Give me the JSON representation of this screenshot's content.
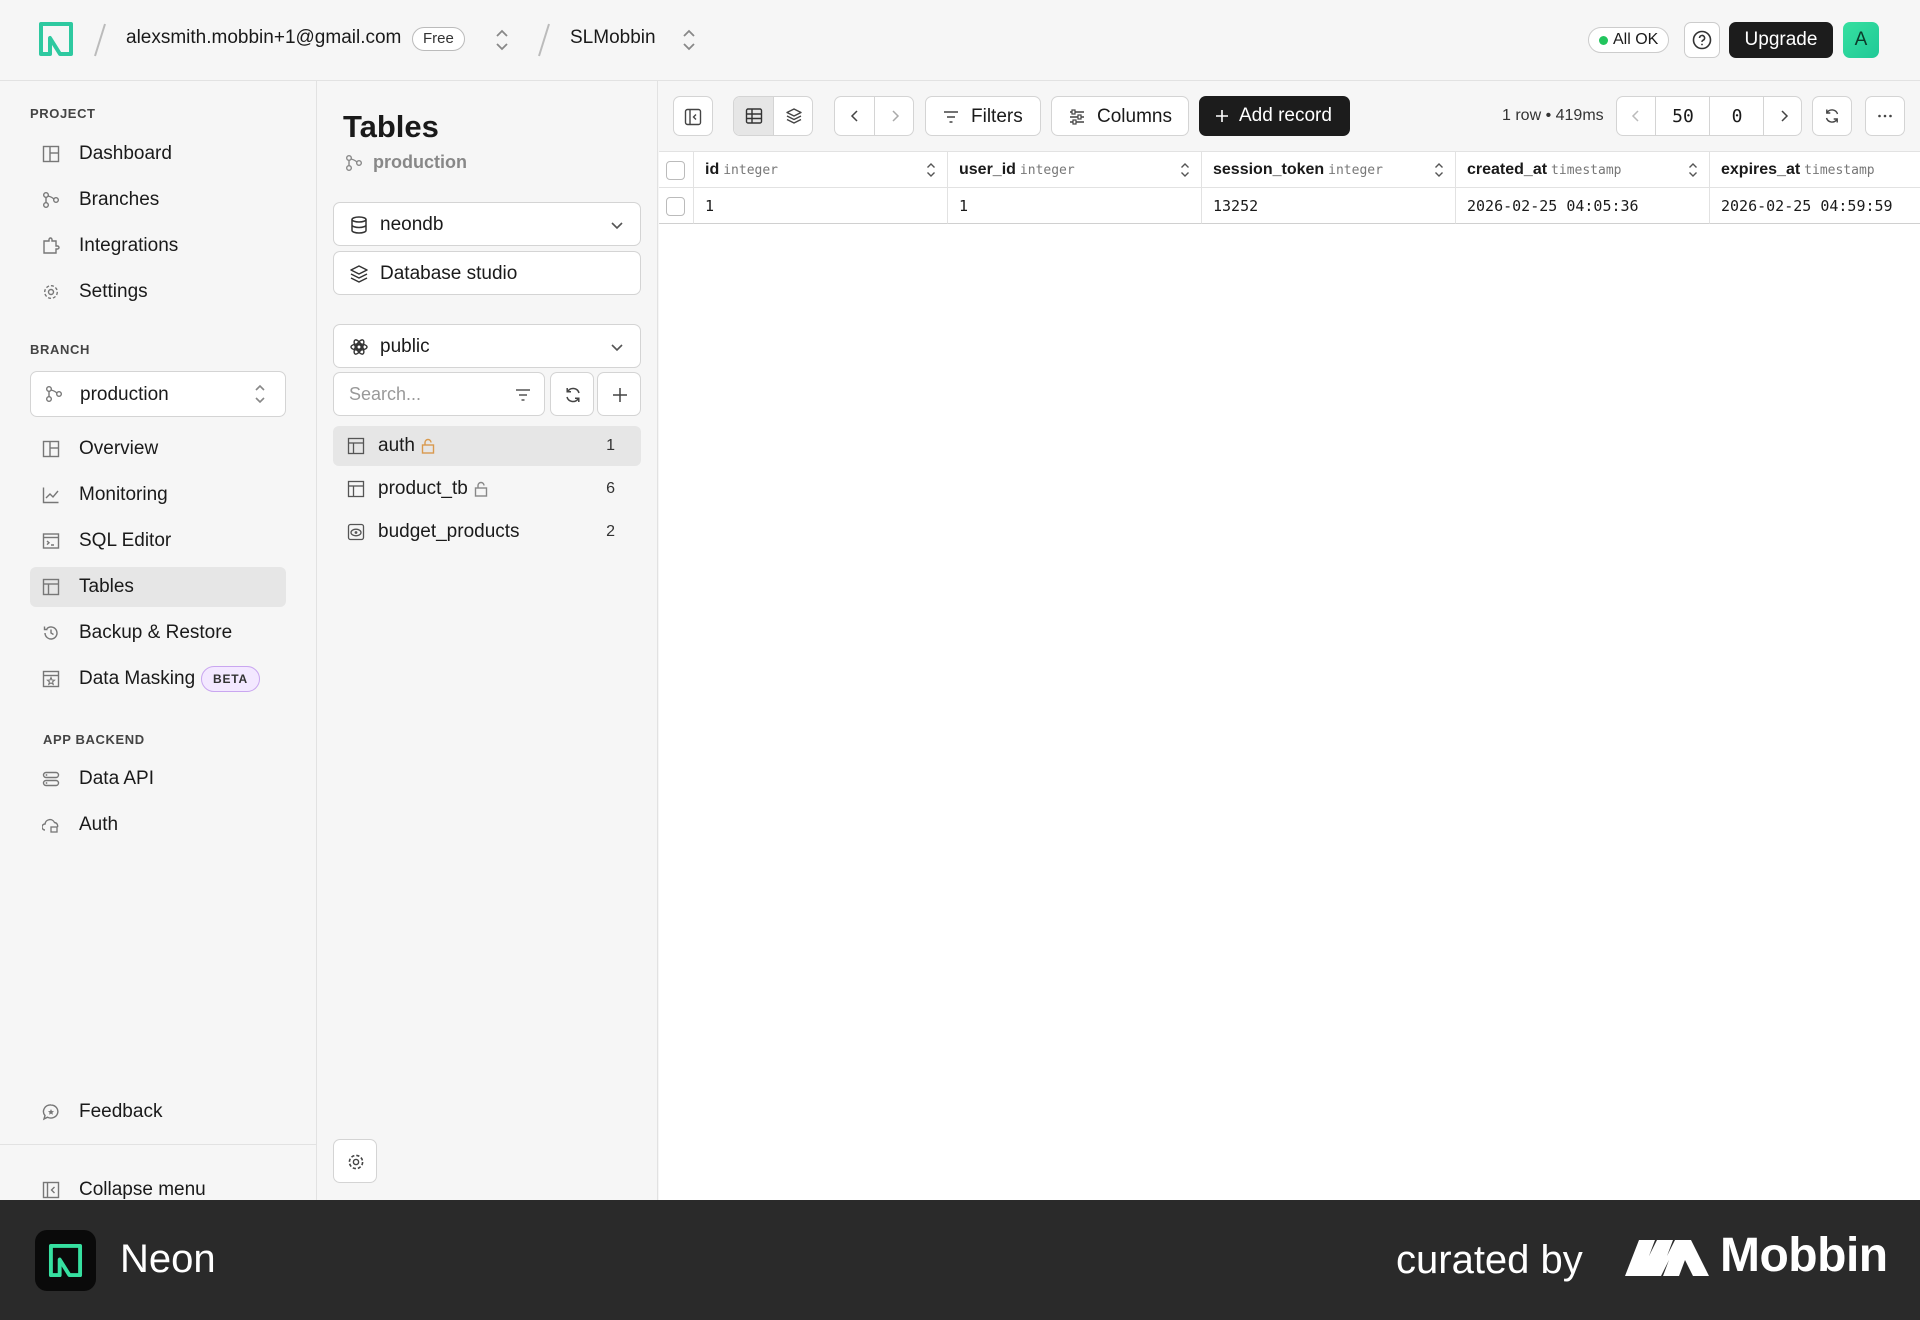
{
  "topbar": {
    "account": "alexsmith.mobbin+1@gmail.com",
    "plan_badge": "Free",
    "project": "SLMobbin",
    "status": "All OK",
    "upgrade_label": "Upgrade",
    "avatar_letter": "A"
  },
  "sidebar": {
    "project_label": "PROJECT",
    "project_items": [
      {
        "label": "Dashboard",
        "icon": "dashboard-icon"
      },
      {
        "label": "Branches",
        "icon": "branches-icon"
      },
      {
        "label": "Integrations",
        "icon": "integrations-icon"
      },
      {
        "label": "Settings",
        "icon": "gear-icon"
      }
    ],
    "branch_label": "BRANCH",
    "branch_selected": "production",
    "branch_items": [
      {
        "label": "Overview",
        "icon": "overview-icon"
      },
      {
        "label": "Monitoring",
        "icon": "chart-icon"
      },
      {
        "label": "SQL Editor",
        "icon": "terminal-icon"
      },
      {
        "label": "Tables",
        "icon": "table-icon",
        "active": true
      },
      {
        "label": "Backup & Restore",
        "icon": "history-icon"
      },
      {
        "label": "Data Masking",
        "icon": "mask-icon",
        "badge": "BETA"
      }
    ],
    "backend_label": "APP BACKEND",
    "backend_items": [
      {
        "label": "Data API",
        "icon": "api-icon"
      },
      {
        "label": "Auth",
        "icon": "auth-icon"
      }
    ],
    "feedback_label": "Feedback",
    "collapse_label": "Collapse menu"
  },
  "tables_panel": {
    "title": "Tables",
    "branch": "production",
    "database": "neondb",
    "studio_label": "Database studio",
    "schema": "public",
    "search_placeholder": "Search...",
    "items": [
      {
        "name": "auth",
        "count": "1",
        "locked": true,
        "active": true,
        "icon": "table-icon"
      },
      {
        "name": "product_tb",
        "count": "6",
        "locked": true,
        "active": false,
        "icon": "table-icon"
      },
      {
        "name": "budget_products",
        "count": "2",
        "locked": false,
        "active": false,
        "icon": "view-icon"
      }
    ]
  },
  "toolbar": {
    "filters_label": "Filters",
    "columns_label": "Columns",
    "add_record_label": "Add record",
    "row_info": "1 row • 419ms",
    "page_size": "50",
    "offset": "0"
  },
  "grid": {
    "columns": [
      {
        "name": "id",
        "type": "integer"
      },
      {
        "name": "user_id",
        "type": "integer"
      },
      {
        "name": "session_token",
        "type": "integer"
      },
      {
        "name": "created_at",
        "type": "timestamp"
      },
      {
        "name": "expires_at",
        "type": "timestamp"
      }
    ],
    "rows": [
      [
        "1",
        "1",
        "13252",
        "2026-02-25 04:05:36",
        "2026-02-25 04:59:59"
      ]
    ]
  },
  "footer": {
    "app_name": "Neon",
    "curated_by": "curated by",
    "brand": "Mobbin"
  },
  "colors": {
    "accent": "#36e0a0",
    "dark": "#1c1c1c",
    "status_ok": "#22c55e"
  }
}
